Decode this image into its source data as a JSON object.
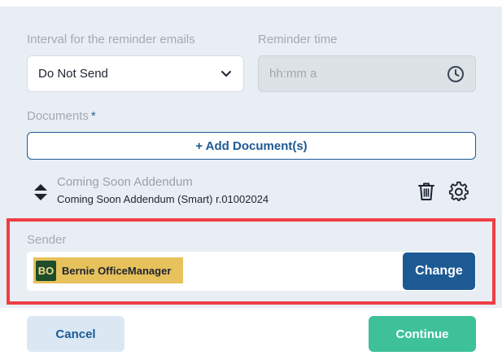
{
  "reminder": {
    "interval_label": "Interval for the reminder emails",
    "interval_value": "Do Not Send",
    "time_label": "Reminder time",
    "time_placeholder": "hh:mm a"
  },
  "documents": {
    "label": "Documents",
    "required_mark": "*",
    "add_button": "+ Add Document(s)",
    "items": [
      {
        "title": "Coming Soon Addendum",
        "subtitle": "Coming Soon Addendum (Smart) r.01002024"
      }
    ]
  },
  "sender": {
    "label": "Sender",
    "initials": "BO",
    "name": "Bernie OfficeManager",
    "change_button": "Change"
  },
  "footer": {
    "cancel": "Cancel",
    "continue": "Continue"
  },
  "colors": {
    "primary": "#1d5a94",
    "continue": "#3ec199",
    "sender_chip": "#e6c15c",
    "highlight": "#ef3e45"
  }
}
